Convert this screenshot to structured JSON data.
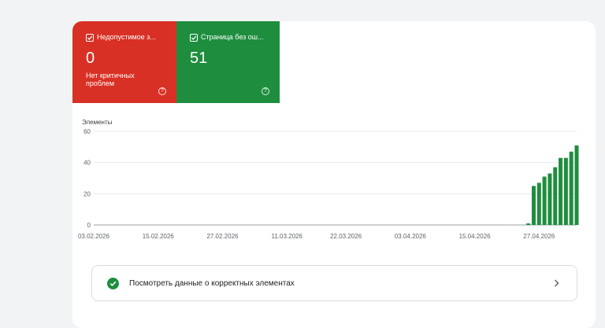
{
  "tiles": {
    "error": {
      "label": "Недопустимое з...",
      "count": "0",
      "sub": "Нет критичных проблем",
      "help": "?",
      "color": "#d93025",
      "icon": "checkbox-checked-icon"
    },
    "valid": {
      "label": "Страница без ош...",
      "count": "51",
      "help": "?",
      "color": "#1e8e3e",
      "icon": "checkbox-checked-icon"
    }
  },
  "chart_data": {
    "type": "bar",
    "ylabel": "Элементы",
    "ylim": [
      0,
      60
    ],
    "yticks": [
      0,
      20,
      40,
      60
    ],
    "grid": true,
    "color": "#1e8e3e",
    "date_ticks": [
      "03.02.2026",
      "15.02.2026",
      "27.02.2026",
      "11.03.2026",
      "22.03.2026",
      "03.04.2026",
      "15.04.2026",
      "27.04.2026"
    ],
    "x": [
      "03.02.2026",
      "04.02.2026",
      "05.02.2026",
      "06.02.2026",
      "07.02.2026",
      "08.02.2026",
      "09.02.2026",
      "10.02.2026",
      "11.02.2026",
      "12.02.2026",
      "13.02.2026",
      "14.02.2026",
      "15.02.2026",
      "16.02.2026",
      "17.02.2026",
      "18.02.2026",
      "19.02.2026",
      "20.02.2026",
      "21.02.2026",
      "22.02.2026",
      "23.02.2026",
      "24.02.2026",
      "25.02.2026",
      "26.02.2026",
      "27.02.2026",
      "28.02.2026",
      "01.03.2026",
      "02.03.2026",
      "03.03.2026",
      "04.03.2026",
      "05.03.2026",
      "06.03.2026",
      "07.03.2026",
      "08.03.2026",
      "09.03.2026",
      "10.03.2026",
      "11.03.2026",
      "12.03.2026",
      "13.03.2026",
      "14.03.2026",
      "15.03.2026",
      "16.03.2026",
      "17.03.2026",
      "18.03.2026",
      "19.03.2026",
      "20.03.2026",
      "21.03.2026",
      "22.03.2026",
      "23.03.2026",
      "24.03.2026",
      "25.03.2026",
      "26.03.2026",
      "27.03.2026",
      "28.03.2026",
      "29.03.2026",
      "30.03.2026",
      "31.03.2026",
      "01.04.2026",
      "02.04.2026",
      "03.04.2026",
      "04.04.2026",
      "05.04.2026",
      "06.04.2026",
      "07.04.2026",
      "08.04.2026",
      "09.04.2026",
      "10.04.2026",
      "11.04.2026",
      "12.04.2026",
      "13.04.2026",
      "14.04.2026",
      "15.04.2026",
      "16.04.2026",
      "17.04.2026",
      "18.04.2026",
      "19.04.2026",
      "20.04.2026",
      "21.04.2026",
      "22.04.2026",
      "23.04.2026",
      "24.04.2026",
      "25.04.2026",
      "26.04.2026",
      "27.04.2026",
      "28.04.2026",
      "29.04.2026",
      "30.04.2026",
      "01.05.2026",
      "02.05.2026",
      "03.05.2026",
      "04.05.2026"
    ],
    "values": [
      0,
      0,
      0,
      0,
      0,
      0,
      0,
      0,
      0,
      0,
      0,
      0,
      0,
      0,
      0,
      0,
      0,
      0,
      0,
      0,
      0,
      0,
      0,
      0,
      0,
      0,
      0,
      0,
      0,
      0,
      0,
      0,
      0,
      0,
      0,
      0,
      0,
      0,
      0,
      0,
      0,
      0,
      0,
      0,
      0,
      0,
      0,
      0,
      0,
      0,
      0,
      0,
      0,
      0,
      0,
      0,
      0,
      0,
      0,
      0,
      0,
      0,
      0,
      0,
      0,
      0,
      0,
      0,
      0,
      0,
      0,
      0,
      0,
      0,
      0,
      0,
      0,
      0,
      0,
      0,
      0,
      1,
      25,
      27,
      31,
      33,
      37,
      43,
      43,
      47,
      51
    ]
  },
  "action": {
    "label": "Посмотреть данные о корректных элементах",
    "icon": "check-circle-icon",
    "chevron": "chevron-right-icon"
  }
}
